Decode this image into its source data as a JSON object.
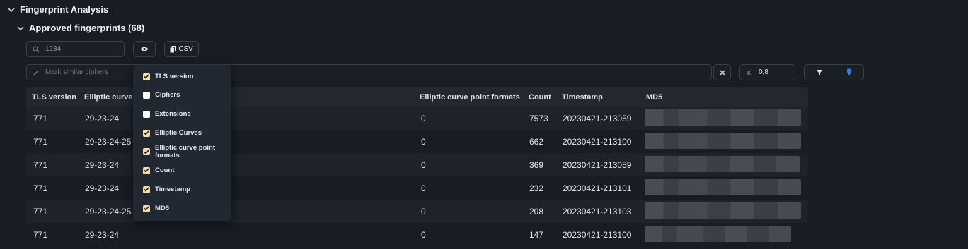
{
  "section": {
    "title": "Fingerprint Analysis"
  },
  "subsection": {
    "title": "Approved fingerprints (68)"
  },
  "toolbar": {
    "search_value": "1234",
    "csv_label": "CSV",
    "mark_placeholder": "Mark similar ciphers",
    "threshold_value": "0,8"
  },
  "columns": {
    "tls": "TLS version",
    "curves": "Elliptic curves",
    "formats": "Elliptic curve point formats",
    "count": "Count",
    "timestamp": "Timestamp",
    "md5": "MD5"
  },
  "rows": [
    {
      "tls": "771",
      "curves": "29-23-24",
      "formats": "0",
      "count": "7573",
      "timestamp": "20230421-213059"
    },
    {
      "tls": "771",
      "curves": "29-23-24-25",
      "formats": "0",
      "count": "662",
      "timestamp": "20230421-213100"
    },
    {
      "tls": "771",
      "curves": "29-23-24",
      "formats": "0",
      "count": "369",
      "timestamp": "20230421-213059"
    },
    {
      "tls": "771",
      "curves": "29-23-24",
      "formats": "0",
      "count": "232",
      "timestamp": "20230421-213101"
    },
    {
      "tls": "771",
      "curves": "29-23-24-25",
      "formats": "0",
      "count": "208",
      "timestamp": "20230421-213103"
    },
    {
      "tls": "771",
      "curves": "29-23-24",
      "formats": "0",
      "count": "147",
      "timestamp": "20230421-213100"
    }
  ],
  "column_menu": [
    {
      "label": "TLS version",
      "checked": true
    },
    {
      "label": "Ciphers",
      "checked": false
    },
    {
      "label": "Extensions",
      "checked": false
    },
    {
      "label": "Elliptic Curves",
      "checked": true
    },
    {
      "label": "Elliptic curve point formats",
      "checked": true
    },
    {
      "label": "Count",
      "checked": true
    },
    {
      "label": "Timestamp",
      "checked": true
    },
    {
      "label": "MD5",
      "checked": true
    }
  ],
  "colors": {
    "background": "#191c23",
    "checkbox_checked": "#f3dfae",
    "accent_blue": "#2f7de1"
  }
}
